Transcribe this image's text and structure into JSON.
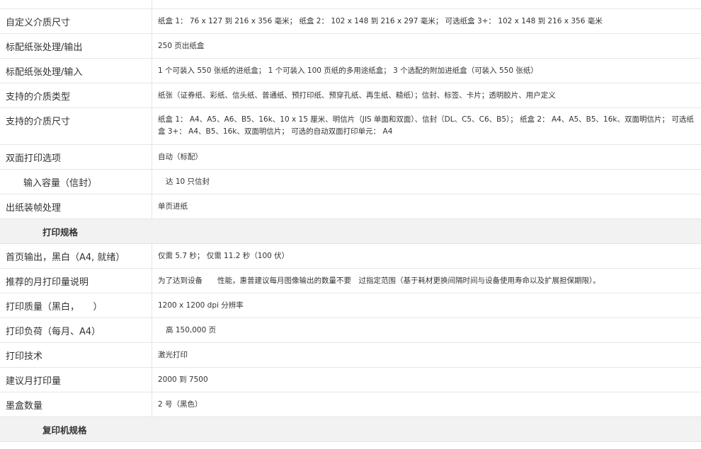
{
  "rows_top": [
    {
      "label": "自定义介质尺寸",
      "value": "纸盒 1： 76 x 127 到 216 x 356 毫米； 纸盒 2： 102 x 148 到 216 x 297 毫米； 可选纸盒 3+： 102 x 148 到 216 x 356 毫米"
    },
    {
      "label": "标配纸张处理/输出",
      "value": "250 页出纸盒"
    },
    {
      "label": "标配纸张处理/输入",
      "value": "1 个可装入 550 张纸的进纸盒； 1 个可装入 100 页纸的多用途纸盒； 3 个选配的附加进纸盒（可装入 550 张纸）"
    },
    {
      "label": "支持的介质类型",
      "value": "纸张（证券纸、彩纸、信头纸、普通纸、预打印纸、预穿孔纸、再生纸、糙纸）；信封、标签、卡片；透明胶片、用户定义"
    },
    {
      "label": "支持的介质尺寸",
      "value": "纸盒 1： A4、A5、A6、B5、16k、10 x 15 厘米、明信片（JIS 单面和双面）、信封（DL、C5、C6、B5）； 纸盒 2： A4、A5、B5、16k、双面明信片； 可选纸盒 3+： A4、B5、16k、双面明信片； 可选的自动双面打印单元： A4"
    },
    {
      "label": "双面打印选项",
      "value": "自动（标配）"
    },
    {
      "label": "输入容量（信封）",
      "value": "达 10 只信封"
    },
    {
      "label": "出纸装帧处理",
      "value": "单页进纸"
    }
  ],
  "section_print": "打印规格",
  "rows_print": [
    {
      "label": "首页输出，黑白（A4, 就绪）",
      "value": "仅需 5.7 秒； 仅需 11.2 秒（100 伏）"
    },
    {
      "label": "推荐的月打印量说明",
      "value": "为了达到设备　　性能，惠普建议每月图像输出的数量不要　过指定范围（基于耗材更换间隔时间与设备使用寿命以及扩展担保期限）。"
    },
    {
      "label": "打印质量（黑白，　　）",
      "value": "1200 x 1200 dpi 分辨率"
    },
    {
      "label": "打印负荷（每月、A4）",
      "value": "高 150,000 页"
    },
    {
      "label": "打印技术",
      "value": "激光打印"
    },
    {
      "label": "建议月打印量",
      "value": "2000 到 7500"
    },
    {
      "label": "墨盒数量",
      "value": "2 号（黑色）"
    }
  ],
  "section_copy": "复印机规格"
}
